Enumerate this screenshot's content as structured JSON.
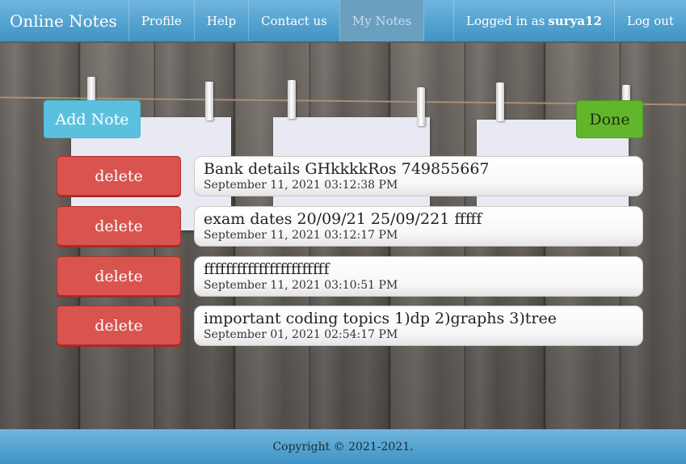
{
  "nav": {
    "brand": "Online Notes",
    "items": [
      {
        "label": "Profile"
      },
      {
        "label": "Help"
      },
      {
        "label": "Contact us"
      },
      {
        "label": "My Notes"
      }
    ],
    "logged_in_prefix": "Logged in as",
    "username": "surya12",
    "logout": "Log out"
  },
  "actions": {
    "add_note": "Add Note",
    "done": "Done"
  },
  "notes": [
    {
      "delete_label": "delete",
      "text": "Bank details GHkkkkRos 749855667",
      "date": "September 11, 2021 03:12:38 PM"
    },
    {
      "delete_label": "delete",
      "text": "exam dates 20/09/21 25/09/221 fffff",
      "date": "September 11, 2021 03:12:17 PM"
    },
    {
      "delete_label": "delete",
      "text": "fffffffffffffffffffffff",
      "date": "September 11, 2021 03:10:51 PM"
    },
    {
      "delete_label": "delete",
      "text": "important coding topics 1)dp 2)graphs 3)tree",
      "date": "September 01, 2021 02:54:17 PM"
    }
  ],
  "footer": {
    "copyright": "Copyright © 2021-2021."
  },
  "colors": {
    "nav": "#3f93c5",
    "add": "#5bc0de",
    "done": "#62b62a",
    "delete": "#d9534f"
  }
}
